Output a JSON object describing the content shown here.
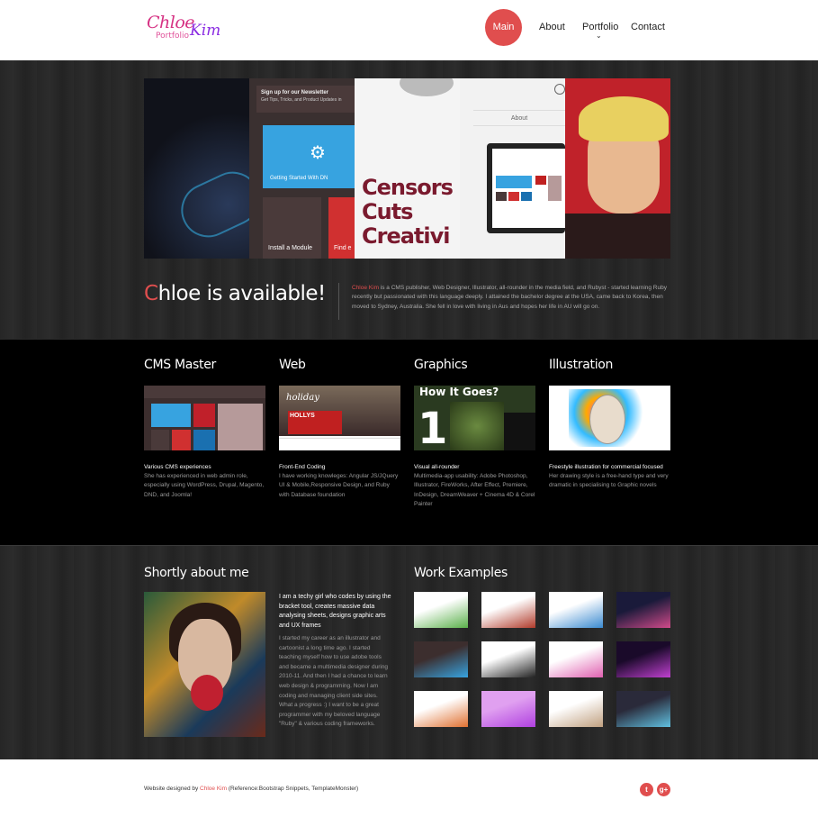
{
  "header": {
    "logo": {
      "chloe": "Chloe",
      "portfolio": "Portfolio",
      "kim": "Kim"
    },
    "nav": {
      "main": "Main",
      "about": "About",
      "portfolio": "Portfolio",
      "contact": "Contact"
    }
  },
  "slider": {
    "slide2": {
      "newsletter_title": "Sign up for our Newsletter",
      "newsletter_sub": "Get Tips, Tricks, and Product Updates in",
      "tile1": "Getting Started With DN",
      "tile2": "Install a Module",
      "tile3": "Find e"
    },
    "slide3": {
      "text": "Censors\nCuts\nCreativi"
    },
    "slide4": {
      "about": "About"
    }
  },
  "available": {
    "title_first": "C",
    "title_rest": "hloe is available!",
    "name": "Chloe Kim",
    "text": " is a CMS publisher, Web Designer, Illustrator, all-rounder in the media field, and Rubyst - started learning Ruby recently but passionated with this language deeply. I attained the bachelor degree at the USA, came back to Korea, then moved to Sydney, Australia. She fell in love with living in Aus and hopes her life in AU will go on."
  },
  "skills": [
    {
      "title": "CMS Master",
      "caption": "Various CMS experiences",
      "desc": "She has experienced in web admin role, especially using WordPress, Drupal, Magento, DND, and Joomla!"
    },
    {
      "title": "Web",
      "caption": "Front-End Coding",
      "desc": "I have working knowleges: Angular JS/JQuery UI & Mobile,Responsive Design, and Ruby with Database foundation",
      "thumb_word": "holiday",
      "thumb_brand": "HOLLYS"
    },
    {
      "title": "Graphics",
      "caption": "Visual all-rounder",
      "desc": "Multimedia-app usability: Adobe Photoshop, Illustrator, FireWorks, After Effect, Premiere, InDesign, DreamWeaver + Cinema 4D & Corel Painter",
      "thumb_heading": "How It Goes?",
      "thumb_number": "1"
    },
    {
      "title": "Illustration",
      "caption": "Freestyle illustration for commercial focused",
      "desc": "Her drawing style is a free-hand type and very dramatic in specialising to Graphic novels"
    }
  ],
  "about": {
    "title": "Shortly about me",
    "intro": "I am a techy girl who codes by using the bracket tool, creates massive data analysing sheets, designs graphic arts and UX frames",
    "text": "I started my career as an illustrator and cartoonist a long time ago. I started teaching myself how to use adobe tools and became a multimedia designer during 2010-11. And then I had a chance to learn web design & programming. Now I am coding and managing client side sites. What a progress :) I want to be a great programmer with my beloved language \"Ruby\" & various coding frameworks."
  },
  "work": {
    "title": "Work Examples",
    "thumbs": [
      {
        "name": "work-thumb-1",
        "colors": [
          "#ffffff",
          "#5ab04a"
        ]
      },
      {
        "name": "work-thumb-2",
        "colors": [
          "#ffffff",
          "#b03a2a"
        ]
      },
      {
        "name": "work-thumb-3",
        "colors": [
          "#ffffff",
          "#3a8ad0"
        ]
      },
      {
        "name": "work-thumb-4",
        "colors": [
          "#1a1a3a",
          "#d04a8a"
        ]
      },
      {
        "name": "work-thumb-5",
        "colors": [
          "#3c2e2e",
          "#37a3e0"
        ]
      },
      {
        "name": "work-thumb-6",
        "colors": [
          "#ffffff",
          "#222222"
        ]
      },
      {
        "name": "work-thumb-7",
        "colors": [
          "#ffffff",
          "#e060b0"
        ]
      },
      {
        "name": "work-thumb-8",
        "colors": [
          "#1a0a2a",
          "#c040d0"
        ]
      },
      {
        "name": "work-thumb-9",
        "colors": [
          "#ffffff",
          "#e07030"
        ]
      },
      {
        "name": "work-thumb-10",
        "colors": [
          "#e0a0f0",
          "#b040e0"
        ]
      },
      {
        "name": "work-thumb-11",
        "colors": [
          "#ffffff",
          "#c0a080"
        ]
      },
      {
        "name": "work-thumb-12",
        "colors": [
          "#2a2a3a",
          "#60c0e0"
        ]
      }
    ]
  },
  "footer": {
    "prefix": "Website designed by ",
    "name": "Chloe Kim",
    "suffix": " (Reference:Bootstrap Snippets, TemplateMonster)",
    "twitter": "t",
    "gplus": "g+"
  },
  "colors": {
    "accent": "#e04e4e",
    "dark_bg": "#262626",
    "black_band": "#000000"
  },
  "icons": [
    "twitter-icon",
    "google-plus-icon",
    "chevron-down-icon",
    "gear-icon"
  ]
}
